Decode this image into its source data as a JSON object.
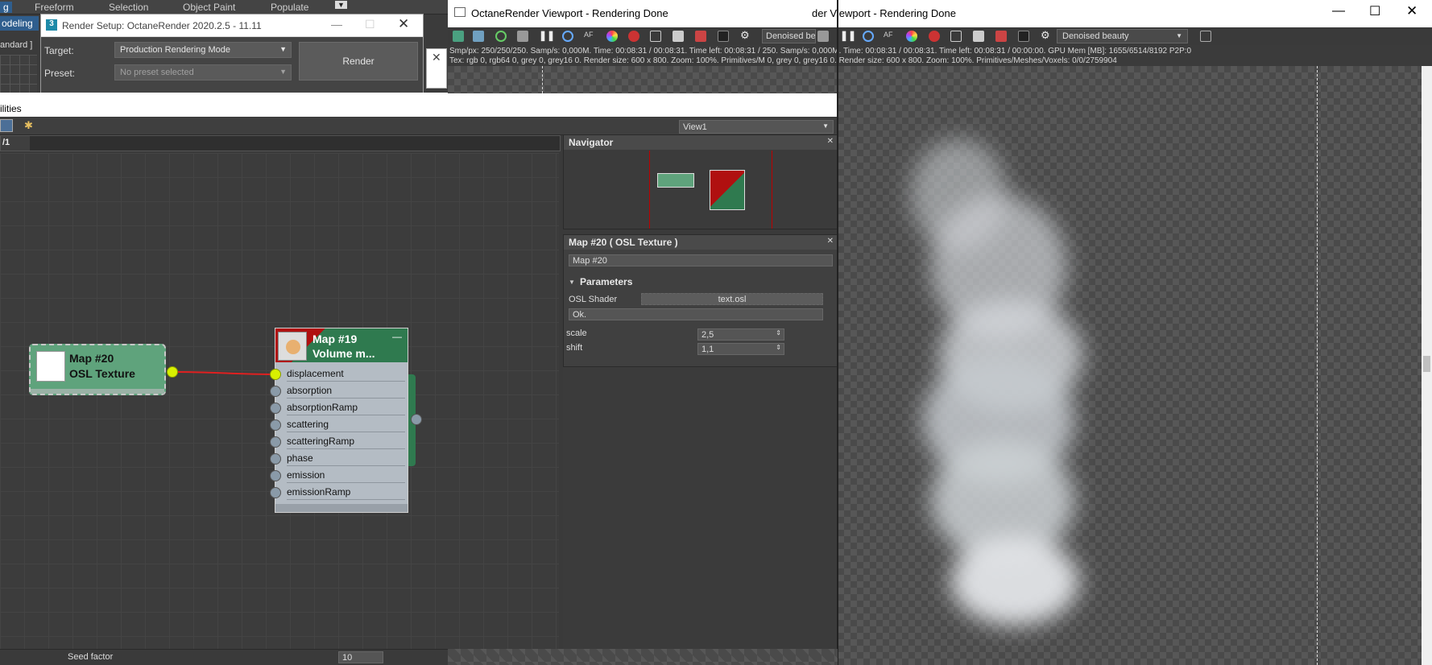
{
  "ribbon": {
    "tabs": [
      "g",
      "Freeform",
      "Selection",
      "Object Paint",
      "Populate"
    ],
    "left_tab_active": "odeling",
    "left_label": "andard ]"
  },
  "render_setup": {
    "title": "Render Setup: OctaneRender 2020.2.5 - 11.11",
    "target_label": "Target:",
    "target_value": "Production Rendering Mode",
    "preset_label": "Preset:",
    "preset_value": "No preset selected",
    "render_button": "Render"
  },
  "slate": {
    "utilities_label": "ilities",
    "view_dropdown": "View1",
    "tab_label": "/1"
  },
  "nodes": {
    "osl": {
      "line1": "Map #20",
      "line2": "OSL Texture"
    },
    "volume": {
      "line1": "Map #19",
      "line2": "Volume m...",
      "slots": [
        "displacement",
        "absorption",
        "absorptionRamp",
        "scattering",
        "scatteringRamp",
        "phase",
        "emission",
        "emissionRamp"
      ]
    }
  },
  "navigator": {
    "title": "Navigator"
  },
  "map_panel": {
    "title": "Map #20  ( OSL Texture )",
    "name_field": "Map #20",
    "rollout": "Parameters",
    "osl_shader_label": "OSL Shader",
    "osl_shader_value": "text.osl",
    "status": "Ok.",
    "params": [
      {
        "label": "scale",
        "value": "2,5"
      },
      {
        "label": "shift",
        "value": "1,1"
      }
    ]
  },
  "viewport": {
    "title": "OctaneRender Viewport - Rendering Done",
    "title_ghost": "der Viewport - Rendering Done",
    "channel_left": "Denoised be",
    "channel_right": "Denoised beauty",
    "info_line1": "Smp/px: 250/250/250.   Samp/s: 0,000M.   Time: 00:08:31 / 00:08:31.   Time left: 00:08:31 / 250.   Samp/s: 0,000M.   Time: 00:08:31 / 00:08:31.   Time left: 00:08:31 / 00:00:00.   GPU Mem [MB]: 1655/6514/8192 P2P:0",
    "info_line2": "Tex: rgb 0, rgb64 0, grey 0, grey16 0.   Render size: 600 x 800.   Zoom: 100%.   Primitives/M 0, grey 0, grey16 0.   Render size: 600 x 800.   Zoom: 100%.   Primitives/Meshes/Voxels: 0/0/2759904"
  },
  "bottom": {
    "seed_label": "Seed factor",
    "seed_value": "10"
  },
  "colors": {
    "accent_green": "#5fa37c",
    "node_red": "#b01010",
    "wire": "#e02020",
    "port_active": "#d8f000"
  }
}
